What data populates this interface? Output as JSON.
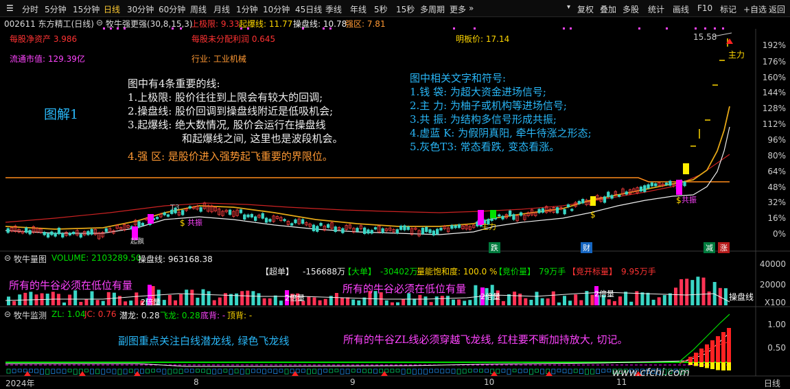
{
  "toolbar": {
    "periods": [
      "分时",
      "5分钟",
      "15分钟",
      "日线",
      "30分钟",
      "60分钟",
      "周线",
      "月线",
      "1分钟",
      "10分钟",
      "45日线",
      "季线",
      "年线",
      "5秒",
      "15秒",
      "多周期",
      "更多"
    ],
    "active": "日线",
    "right": [
      "复权",
      "叠加",
      "多股",
      "统计",
      "画线",
      "F10",
      "标记",
      "+自选",
      "返回"
    ]
  },
  "header": {
    "code_name": "002611 东方精工(日线)",
    "indicator": "牧牛强更强(30,8,15,3)",
    "upper_limit": "上极限: 9.33",
    "breakout": "起爆线: 11.77",
    "trading_line": "操盘线: 10.78",
    "strong_zone": "强区: 7.81"
  },
  "info": {
    "net_assets": "每股净资产 3.986",
    "undistributed": "每股未分配利润 0.645",
    "float_cap": "流通市值: 129.39亿",
    "industry": "行业: 工业机械",
    "limit_price": "明板价: 17.14",
    "high_price": "15.58",
    "zhuli": "主力"
  },
  "annotations": {
    "title": "图解1",
    "lines_intro": "图中有4条重要的线:",
    "line1": "1.上极限: 股价往往到上限会有较大的回调;",
    "line2": "2.操盘线: 股价回调到操盘线附近是低吸机会;",
    "line3": "3.起爆线: 绝大数情况, 股价会运行在操盘线",
    "line3b": "和起爆线之间, 这里也是波段机会。",
    "line4": "4.强 区: 是股价进入强势起飞重要的界限位。",
    "symbols_intro": "图中相关文字和符号:",
    "sym1": "1.钱 袋: 为超大资金进场信号;",
    "sym2": "2.主 力: 为柚子或机构等进场信号;",
    "sym3": "3.共 振: 为结构多信号形成共振;",
    "sym4": "4.虚蓝 K: 为假阴真阳, 牵牛待涨之形态;",
    "sym5": "5.灰色T3: 常态看跌, 变态看涨。"
  },
  "price_axis": [
    "192%",
    "176%",
    "160%",
    "144%",
    "128%",
    "112%",
    "96%",
    "80%",
    "64%",
    "48%",
    "32%",
    "16%",
    "0%"
  ],
  "chart_tags": {
    "die": "跌",
    "cai": "财",
    "jian": "减",
    "zhang": "涨",
    "gongzhen1": "共振",
    "gongzhen2": "共振",
    "zhuli_small": "主力",
    "T3": "T3",
    "qibao": "起飘"
  },
  "volume_panel": {
    "name": "牧牛量图",
    "volume": "VOLUME: 2103289.50",
    "trading_line": "操盘线: 963168.38",
    "super": "【超单】",
    "super_val": "-156688万",
    "big": "【大单】",
    "big_val": "-30402万",
    "saturation": "量能饱和度: 100.0 %",
    "bid_vol": "【竞价量】",
    "bid_vol_val": "79万手",
    "open_vol": "【竞开标量】",
    "open_vol_val": "9.95万手",
    "note1": "所有的牛谷必须在低位有量",
    "note2": "所有的牛谷必须在低位有量",
    "beiliang": "2倍量",
    "line_label": "操盘线",
    "axis": [
      "40000",
      "20000",
      "X100"
    ]
  },
  "monitor_panel": {
    "name": "牧牛监测",
    "zl": "ZL: 1.04",
    "jc": "JC: 0.76",
    "qianlong": "潜龙: 0.28",
    "feilong": "飞龙: 0.28",
    "dibei": "底背: -",
    "dingbei": "顶背: -",
    "note1": "副图重点关注白线潜龙线, 绿色飞龙线",
    "note2": "所有的牛谷ZL线必须穿越飞龙线, 红柱要不断加持放大, 切记。",
    "axis": [
      "1.00",
      "0.50"
    ]
  },
  "dates": [
    "2024年",
    "8",
    "9",
    "10",
    "11"
  ],
  "period_label": "日线",
  "watermark": "www.cfchi.com"
}
